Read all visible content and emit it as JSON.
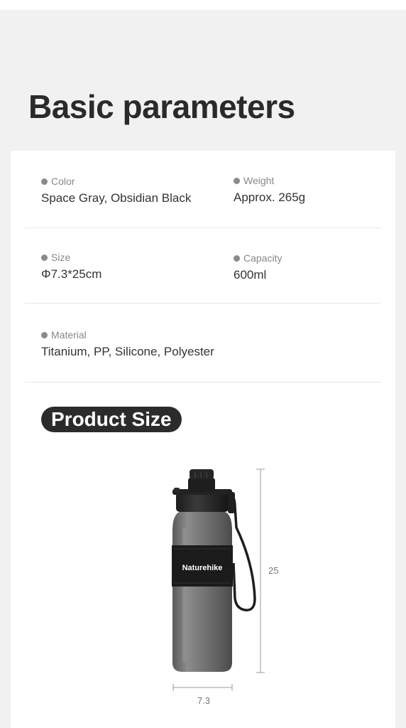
{
  "heading": "Basic parameters",
  "params": {
    "color": {
      "label": "Color",
      "value": "Space Gray, Obsidian Black"
    },
    "weight": {
      "label": "Weight",
      "value": "Approx. 265g"
    },
    "size": {
      "label": "Size",
      "value": "Φ7.3*25cm"
    },
    "capacity": {
      "label": "Capacity",
      "value": "600ml"
    },
    "material": {
      "label": "Material",
      "value": "Titanium, PP, Silicone, Polyester"
    }
  },
  "product_size": {
    "title": "Product Size",
    "brand_band_text": "Naturehike",
    "height_value": "25",
    "width_value": "7.3"
  },
  "colors": {
    "background": "#f1f1f1",
    "card": "#ffffff",
    "pill": "#2b2b2b",
    "bottle_body": "#707070"
  }
}
